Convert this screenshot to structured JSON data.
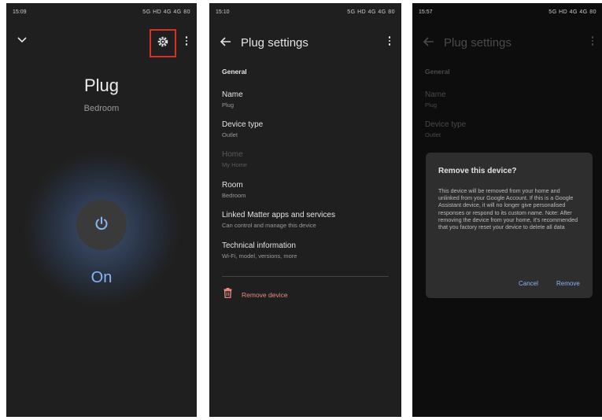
{
  "screen1": {
    "status_time": "15:09",
    "status_right": "5G HD 4G 4G 80",
    "title": "Plug",
    "subtitle": "Bedroom",
    "state": "On"
  },
  "screen2": {
    "status_time": "15:10",
    "status_right": "5G HD 4G 4G 80",
    "header_title": "Plug settings",
    "section": "General",
    "items": [
      {
        "title": "Name",
        "value": "Plug"
      },
      {
        "title": "Device type",
        "value": "Outlet"
      },
      {
        "title": "Home",
        "value": "My Home"
      },
      {
        "title": "Room",
        "value": "Bedroom"
      },
      {
        "title": "Linked Matter apps and services",
        "value": "Can control and manage this device"
      },
      {
        "title": "Technical information",
        "value": "Wi-Fi, model, versions, more"
      }
    ],
    "remove_label": "Remove device"
  },
  "screen3": {
    "status_time": "15:57",
    "status_right": "5G HD 4G 4G 80",
    "header_title": "Plug settings",
    "section": "General",
    "items": [
      {
        "title": "Name",
        "value": "Plug"
      },
      {
        "title": "Device type",
        "value": "Outlet"
      }
    ],
    "dialog": {
      "title": "Remove this device?",
      "body": "This device will be removed from your home and unlinked from your Google Account. If this is a Google Assistant device, it will no longer give personalised responses or respond to its custom name. Note: After removing the device from your home, it's recommended that you factory reset your device to delete all data",
      "cancel": "Cancel",
      "confirm": "Remove"
    }
  },
  "colors": {
    "accent": "#8ab4f8",
    "highlight_box": "#d93025",
    "danger": "#e88b80"
  }
}
